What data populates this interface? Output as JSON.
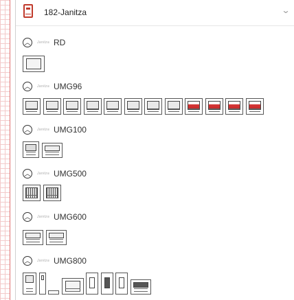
{
  "library": {
    "title": "182-Janitza",
    "icon": "device-library-icon",
    "dropdown_icon": "chevron-down-icon"
  },
  "brand_label": "Janitza",
  "sections": [
    {
      "title": "RD",
      "count": 1
    },
    {
      "title": "UMG96",
      "count": 12
    },
    {
      "title": "UMG100",
      "count": 2
    },
    {
      "title": "UMG500",
      "count": 2
    },
    {
      "title": "UMG600",
      "count": 2
    },
    {
      "title": "UMG800",
      "count": 8
    }
  ],
  "colors": {
    "accent": "#c0392b",
    "grid": "#f3caca"
  }
}
